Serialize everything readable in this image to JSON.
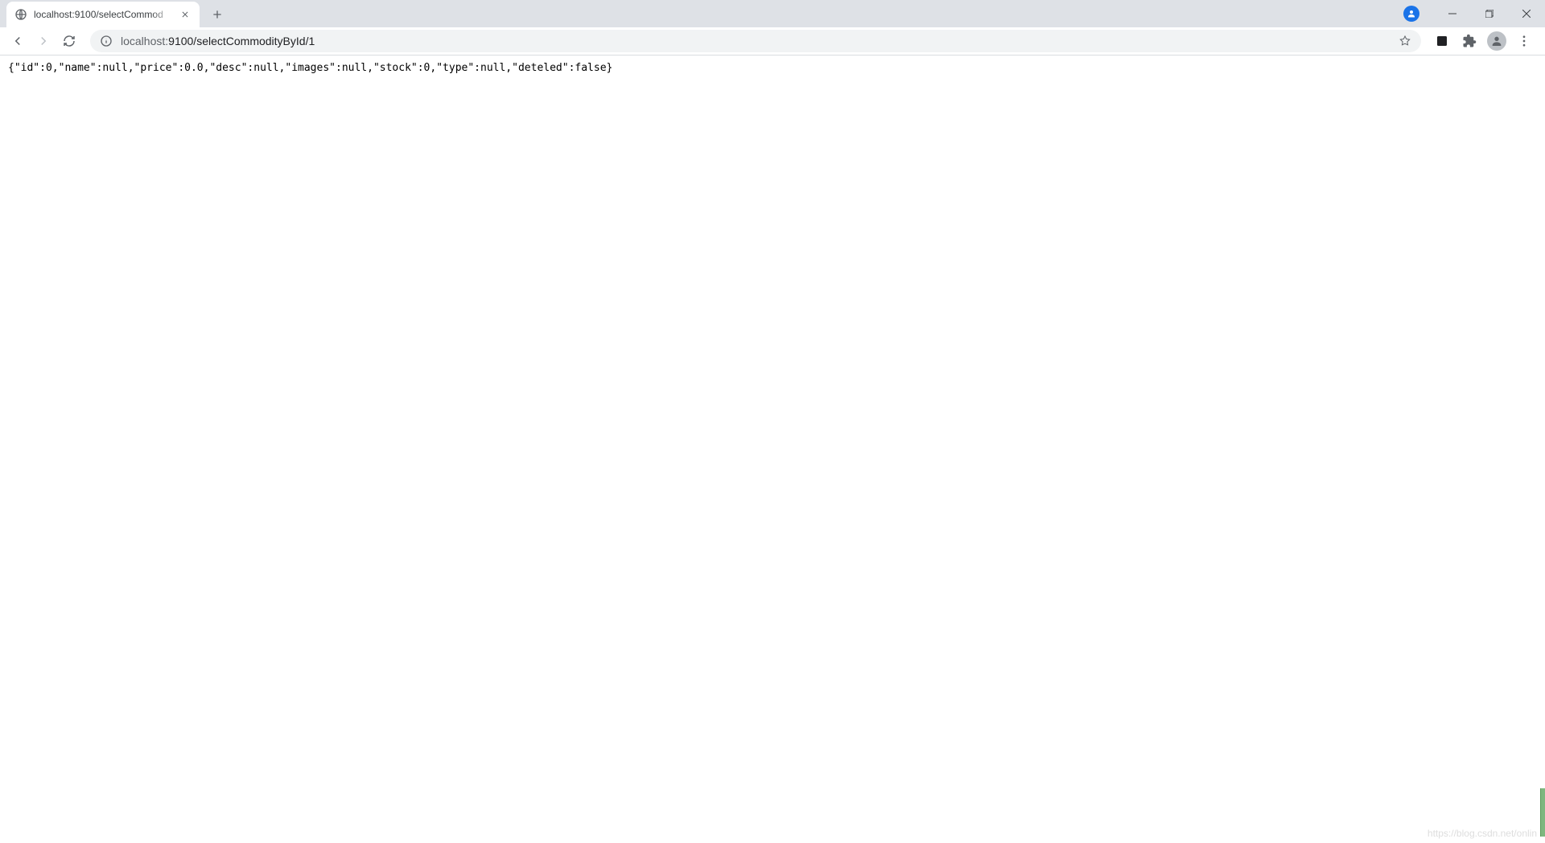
{
  "tab": {
    "title": "localhost:9100/selectCommod"
  },
  "addressbar": {
    "host": "localhost:",
    "port_path": "9100/selectCommodityById/1"
  },
  "page": {
    "body_text": "{\"id\":0,\"name\":null,\"price\":0.0,\"desc\":null,\"images\":null,\"stock\":0,\"type\":null,\"deteled\":false}"
  },
  "watermark": {
    "text": "https://blog.csdn.net/onlin"
  }
}
